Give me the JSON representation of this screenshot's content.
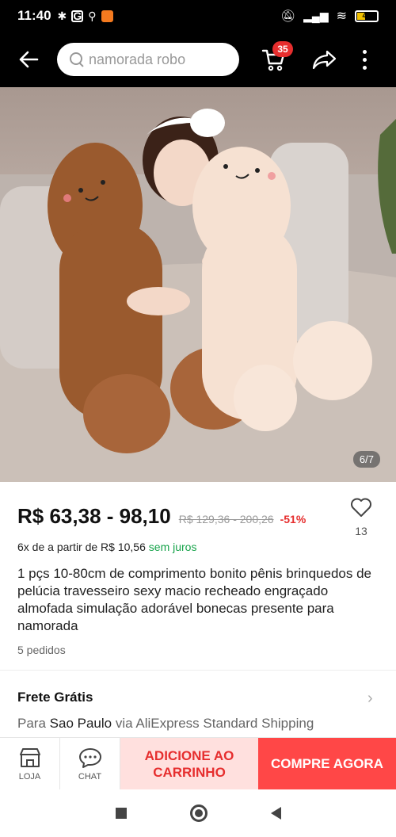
{
  "status_bar": {
    "time": "11:40",
    "battery": "40"
  },
  "search": {
    "placeholder": "namorada robo"
  },
  "cart": {
    "count": "35"
  },
  "image": {
    "counter": "6/7"
  },
  "product": {
    "price": "R$ 63,38 - 98,10",
    "old_price": "R$ 129,36 - 200,26",
    "discount": "-51%",
    "wishlist_count": "13",
    "installments_prefix": "6x de a partir de R$ 10,56",
    "installments_suffix": "sem juros",
    "title": "1 pçs 10-80cm de comprimento bonito pênis brinquedos de pelúcia travesseiro sexy macio recheado engraçado almofada simulação adorável bonecas presente para namorada",
    "orders": "5 pedidos"
  },
  "shipping": {
    "title": "Frete Grátis",
    "prefix": "Para",
    "city": "Sao Paulo",
    "via": "via AliExpress Standard Shipping"
  },
  "actions": {
    "store_label": "LOJA",
    "chat_label": "CHAT",
    "add_to_cart": "ADICIONE AO CARRINHO",
    "buy_now": "COMPRE AGORA"
  },
  "colors": {
    "accent": "#ff4747",
    "accent_light": "#ffe0de",
    "green": "#16a34a",
    "discount": "#e62e2e"
  }
}
